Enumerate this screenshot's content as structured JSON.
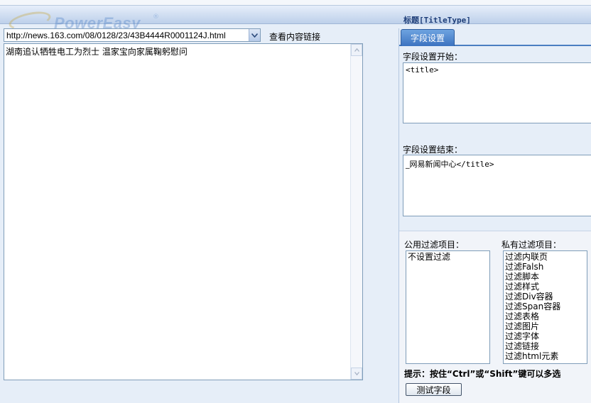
{
  "header": {
    "logo_text": "PowerEasy",
    "logo_reg": "®",
    "title": "标题[TitleType]"
  },
  "url_bar": {
    "selected_url": "http://news.163.com/08/0128/23/43B4444R0001124J.html",
    "view_link": "查看内容链接"
  },
  "content": {
    "text": "湖南追认牺牲电工为烈士 温家宝向家属鞠躬慰问"
  },
  "tabs": [
    {
      "label": "字段设置",
      "active": true
    }
  ],
  "field_settings": {
    "start_label": "字段设置开始：",
    "start_value": "<title>",
    "end_label": "字段设置结束：",
    "end_value_prefix": "_网易新闻中心",
    "end_value_tag": "</title>"
  },
  "filters": {
    "public_label": "公用过滤项目：",
    "public_items": [
      "不设置过滤"
    ],
    "private_label": "私有过滤项目：",
    "private_items": [
      "过滤内联页",
      "过滤Falsh",
      "过滤脚本",
      "过滤样式",
      "过滤Div容器",
      "过滤Span容器",
      "过滤表格",
      "过滤图片",
      "过滤字体",
      "过滤链接",
      "过滤html元素"
    ]
  },
  "hint": "提示：按住“Ctrl”或“Shift”键可以多选",
  "test_button": "测试字段",
  "colors": {
    "tab_active": "#3c73c0",
    "header_title": "#1f3f7a",
    "border": "#7f9db9"
  }
}
